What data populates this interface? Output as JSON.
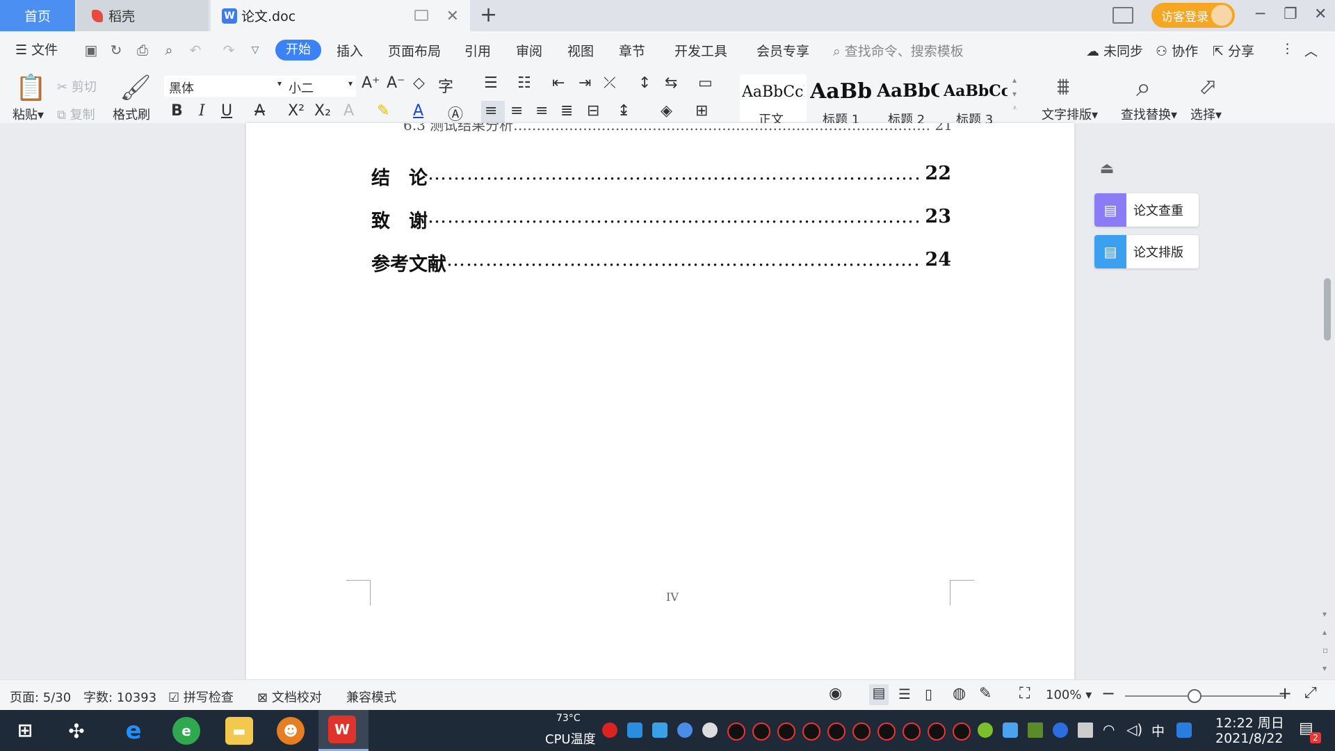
{
  "titlebar": {
    "tabs": [
      {
        "label": "首页"
      },
      {
        "label": "稻壳"
      },
      {
        "label": "论文.doc"
      }
    ],
    "new_tab": "+",
    "login_label": "访客登录",
    "win_min": "─",
    "win_restore": "❐",
    "win_close": "✕"
  },
  "menu": {
    "file": "文件",
    "items": [
      "开始",
      "插入",
      "页面布局",
      "引用",
      "审阅",
      "视图",
      "章节",
      "开发工具",
      "会员专享"
    ],
    "search_placeholder": "查找命令、搜索模板",
    "unsynced": "未同步",
    "collab": "协作",
    "share": "分享"
  },
  "ribbon": {
    "paste": "粘贴",
    "cut": "剪切",
    "copy": "复制",
    "format_painter": "格式刷",
    "font_name": "黑体",
    "font_size": "小二",
    "styles": [
      {
        "preview": "AaBbCcI",
        "name": "正文"
      },
      {
        "preview": "AaBb(",
        "name": "标题 1"
      },
      {
        "preview": "AaBbC",
        "name": "标题 2"
      },
      {
        "preview": "AaBbCcl",
        "name": "标题 3"
      }
    ],
    "text_layout": "文字排版",
    "find_replace": "查找替换",
    "select": "选择"
  },
  "document": {
    "partial_line": "6.3  测试结果分析……………………………………………………………………………… 21",
    "toc": [
      {
        "title": "结　论",
        "page": "22"
      },
      {
        "title": "致　谢",
        "page": "23"
      },
      {
        "title": "参考文献",
        "page": "24"
      }
    ],
    "page_number": "IV"
  },
  "side_panel": {
    "check": "论文查重",
    "layout": "论文排版"
  },
  "status": {
    "page": "页面: 5/30",
    "words": "字数: 10393",
    "spell": "拼写检查",
    "proof": "文档校对",
    "compat": "兼容模式",
    "zoom": "100%"
  },
  "taskbar": {
    "cpu_temp": "73°C",
    "cpu_label": "CPU温度",
    "ime": "中",
    "time": "12:22 周日",
    "date": "2021/8/22",
    "notify_count": "2"
  },
  "colors": {
    "accent": "#3b82f6",
    "login": "#f5a623",
    "taskbar": "#1f2a38"
  }
}
